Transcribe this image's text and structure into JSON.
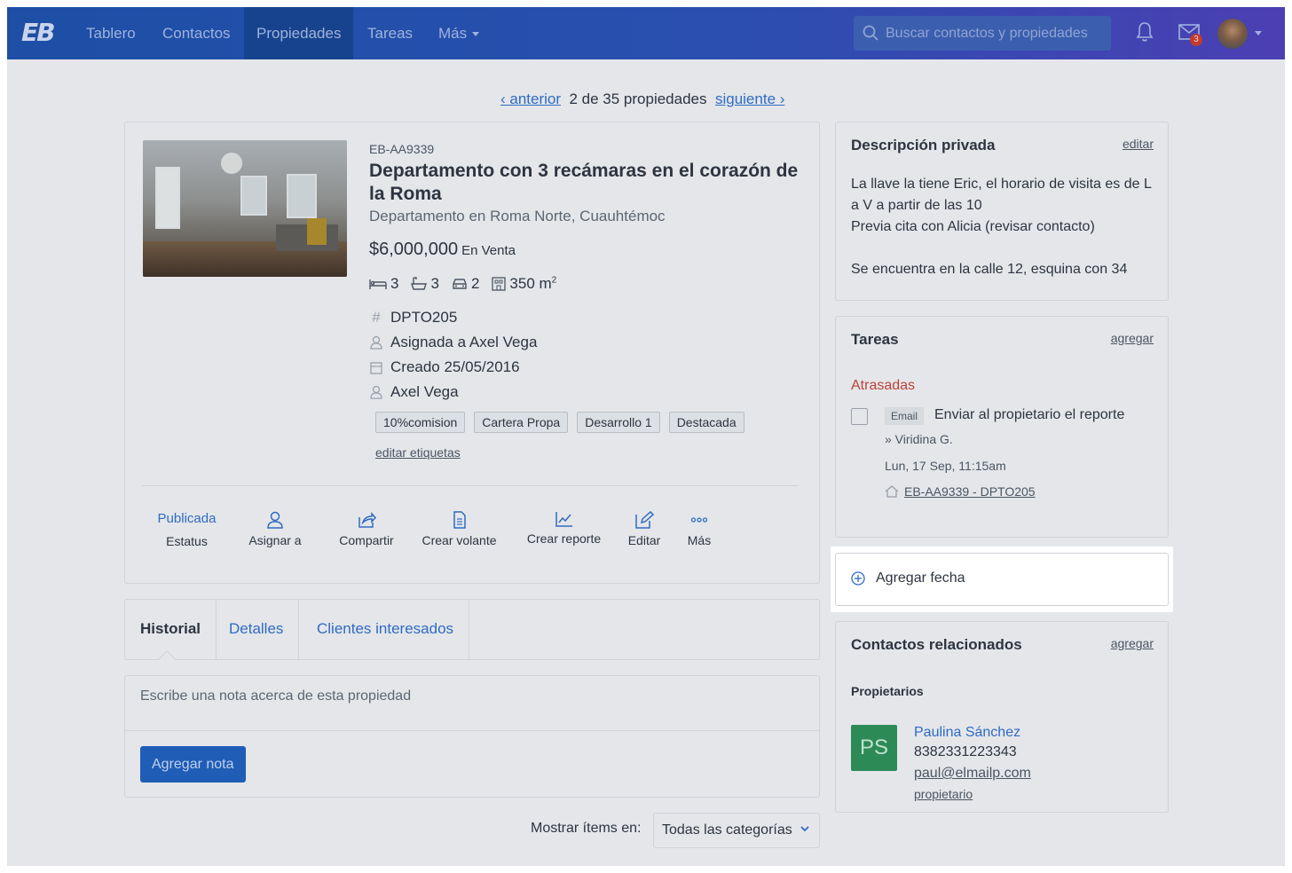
{
  "nav": {
    "logo": "EB",
    "items": [
      "Tablero",
      "Contactos",
      "Propiedades",
      "Tareas",
      "Más"
    ],
    "search_placeholder": "Buscar contactos y propiedades",
    "mail_badge": "3"
  },
  "pager": {
    "prev": "‹ anterior",
    "position": "2 de 35 propiedades",
    "next": "siguiente ›"
  },
  "property": {
    "id": "EB-AA9339",
    "title": "Departamento con 3 recámaras en el corazón de la Roma",
    "subtitle": "Departamento en Roma Norte, Cuauhtémoc",
    "price": "$6,000,000",
    "operation": "En Venta",
    "bedrooms": "3",
    "bathrooms": "3",
    "parking": "2",
    "area": "350 m",
    "area_unit_sup": "2",
    "internal_id": "DPTO205",
    "assigned": "Asignada a Axel Vega",
    "created": "Creado 25/05/2016",
    "agent": "Axel Vega",
    "tags": [
      "10%comision",
      "Cartera Propa",
      "Desarrollo 1",
      "Destacada"
    ],
    "edit_tags": "editar etiquetas"
  },
  "actions": {
    "status_value": "Publicada",
    "status_label": "Estatus",
    "assign": "Asignar a",
    "share": "Compartir",
    "flyer": "Crear volante",
    "report": "Crear reporte",
    "edit": "Editar",
    "more": "Más"
  },
  "tabs": [
    "Historial",
    "Detalles",
    "Clientes interesados"
  ],
  "note": {
    "placeholder": "Escribe una nota acerca de esta propiedad",
    "button": "Agregar nota"
  },
  "filter": {
    "label": "Mostrar ítems en:",
    "selected": "Todas las categorías"
  },
  "private_description": {
    "title": "Descripción privada",
    "edit": "editar",
    "text": "La llave la tiene Eric, el horario de visita es de L a V a partir de las 10\nPrevia cita con Alicia (revisar contacto)\n\nSe encuentra en la calle 12, esquina con 34"
  },
  "tasks": {
    "title": "Tareas",
    "add": "agregar",
    "overdue_label": "Atrasadas",
    "item": {
      "type": "Email",
      "text": "Enviar al propietario el reporte",
      "assignee": "» Viridina G.",
      "date": "Lun, 17 Sep, 11:15am",
      "property_link": "EB-AA9339 - DPTO205"
    }
  },
  "add_date": {
    "label": "Agregar fecha"
  },
  "related_contacts": {
    "title": "Contactos relacionados",
    "add": "agregar",
    "owners_label": "Propietarios",
    "contact": {
      "initials": "PS",
      "name": "Paulina Sánchez",
      "phone": "8382331223343",
      "email": "paul@elmailp.com",
      "role": "propietario"
    }
  },
  "colors": {
    "topbar_start": "#1d4fa5",
    "topbar_end": "#4b3fb3",
    "link_blue": "#2f6bc4",
    "overdue_red": "#b9423a",
    "avatar_green": "#2c8a57",
    "primary_button": "#1f5db6"
  }
}
